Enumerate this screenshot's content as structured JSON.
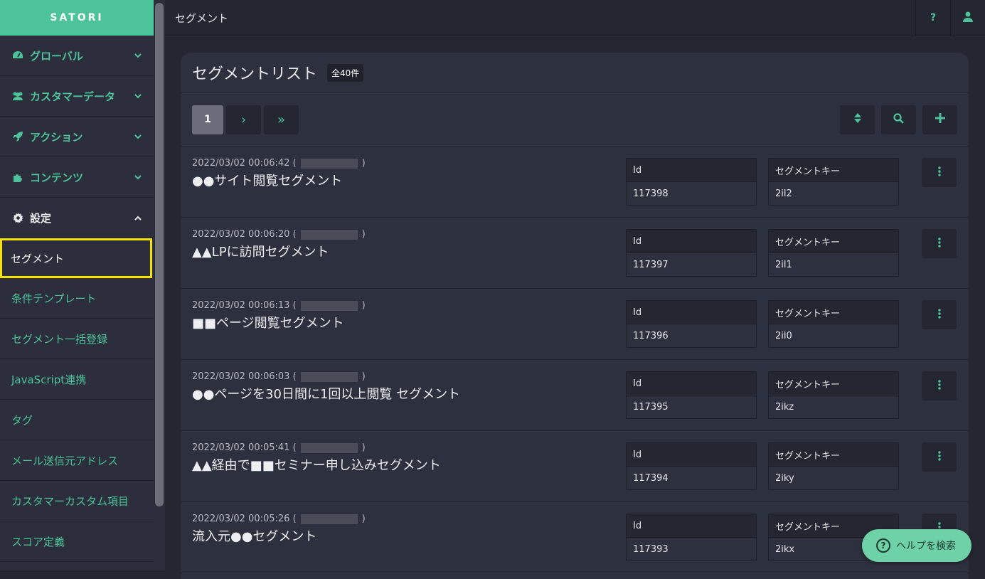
{
  "brand": {
    "name": "SATORI"
  },
  "sidebar": {
    "groups": [
      {
        "label": "グローバル",
        "icon": "dashboard-icon"
      },
      {
        "label": "カスタマーデータ",
        "icon": "users-icon"
      },
      {
        "label": "アクション",
        "icon": "rocket-icon"
      },
      {
        "label": "コンテンツ",
        "icon": "puzzle-icon"
      },
      {
        "label": "設定",
        "icon": "gear-icon",
        "expanded": true
      }
    ],
    "settings_items": [
      {
        "label": "セグメント",
        "active": true
      },
      {
        "label": "条件テンプレート"
      },
      {
        "label": "セグメント一括登録"
      },
      {
        "label": "JavaScript連携"
      },
      {
        "label": "タグ"
      },
      {
        "label": "メール送信元アドレス"
      },
      {
        "label": "カスタマーカスタム項目"
      },
      {
        "label": "スコア定義"
      }
    ]
  },
  "topbar": {
    "title": "セグメント",
    "help_label": "?",
    "user_icon": "user-icon"
  },
  "panel": {
    "title": "セグメントリスト",
    "count_badge": "全40件",
    "pagination": {
      "current_page": "1",
      "next": "›",
      "last": "»"
    },
    "tools": [
      "sort-icon",
      "search-icon",
      "plus-icon"
    ]
  },
  "labels": {
    "id": "Id",
    "segment_key": "セグメントキー"
  },
  "segments": [
    {
      "datetime": "2022/03/02 00:06:42 (",
      "paren_close": ")",
      "name": "●●サイト閲覧セグメント",
      "id": "117398",
      "key": "2il2"
    },
    {
      "datetime": "2022/03/02 00:06:20 (",
      "paren_close": ")",
      "name": "▲▲LPに訪問セグメント",
      "id": "117397",
      "key": "2il1"
    },
    {
      "datetime": "2022/03/02 00:06:13 (",
      "paren_close": ")",
      "name": "■■ページ閲覧セグメント",
      "id": "117396",
      "key": "2il0"
    },
    {
      "datetime": "2022/03/02 00:06:03 (",
      "paren_close": ")",
      "name": "●●ページを30日間に1回以上閲覧 セグメント",
      "id": "117395",
      "key": "2ikz"
    },
    {
      "datetime": "2022/03/02 00:05:41 (",
      "paren_close": ")",
      "name": "▲▲経由で■■セミナー申し込みセグメント",
      "id": "117394",
      "key": "2iky"
    },
    {
      "datetime": "2022/03/02 00:05:26 (",
      "paren_close": ")",
      "name": "流入元●●セグメント",
      "id": "117393",
      "key": "2ikx"
    }
  ],
  "help_button": {
    "label": "ヘルプを検索"
  },
  "colors": {
    "accent": "#4cc39a",
    "highlight": "#f5e400",
    "background": "#242631",
    "panel": "#2d303d"
  }
}
